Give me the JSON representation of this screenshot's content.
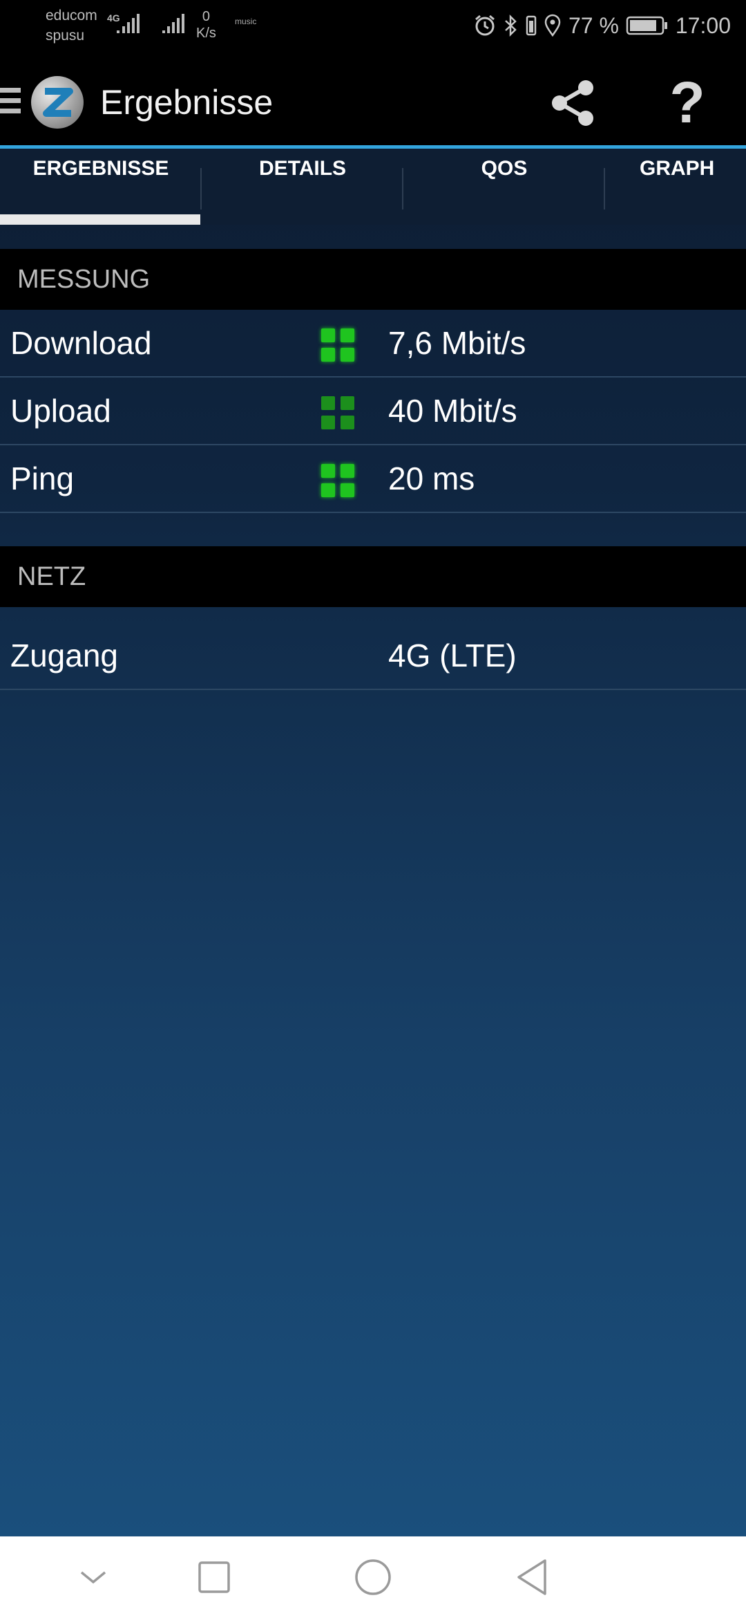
{
  "status_bar": {
    "carrier_1": "educom",
    "carrier_2": "spusu",
    "network_label": "4G",
    "speed_value": "0",
    "speed_unit": "K/s",
    "music_label": "music",
    "battery": "77 %",
    "time": "17:00"
  },
  "app_bar": {
    "title": "Ergebnisse"
  },
  "tabs": [
    {
      "label": "ERGEBNISSE",
      "active": true
    },
    {
      "label": "DETAILS",
      "active": false
    },
    {
      "label": "QOS",
      "active": false
    },
    {
      "label": "GRAPH",
      "active": false
    }
  ],
  "sections": {
    "messung": {
      "title": "MESSUNG",
      "rows": [
        {
          "label": "Download",
          "value": "7,6 Mbit/s",
          "quality_icon": "quality-grid-icon",
          "quality_color": "#1fc41f"
        },
        {
          "label": "Upload",
          "value": "40 Mbit/s",
          "quality_icon": "quality-grid-icon",
          "quality_color": "#1c8f1c"
        },
        {
          "label": "Ping",
          "value": "20 ms",
          "quality_icon": "quality-grid-icon",
          "quality_color": "#1fc41f"
        }
      ]
    },
    "netz": {
      "title": "NETZ",
      "rows": [
        {
          "label": "Zugang",
          "value": "4G (LTE)"
        }
      ]
    }
  },
  "colors": {
    "accent": "#33a4dd",
    "quality_good": "#1fc41f",
    "quality_medium": "#1c8f1c"
  }
}
